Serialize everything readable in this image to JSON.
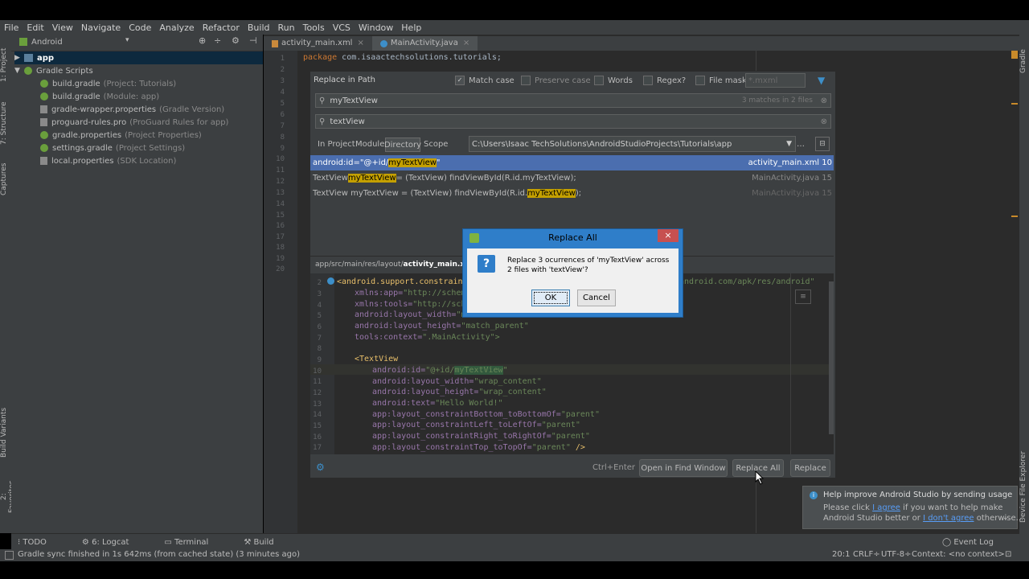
{
  "menu": [
    "File",
    "Edit",
    "View",
    "Navigate",
    "Code",
    "Analyze",
    "Refactor",
    "Build",
    "Run",
    "Tools",
    "VCS",
    "Window",
    "Help"
  ],
  "left_strip": {
    "project": "1: Project",
    "structure": "7: Structure",
    "captures": "Captures",
    "build_variants": "Build Variants",
    "favorites": "2: Favorites"
  },
  "right_strip": {
    "gradle": "Gradle",
    "device_explorer": "Device File Explorer"
  },
  "project": {
    "view": "Android",
    "tree": [
      {
        "label": "app",
        "sub": ""
      },
      {
        "label": "Gradle Scripts",
        "sub": ""
      },
      {
        "label": "build.gradle",
        "sub": "(Project: Tutorials)"
      },
      {
        "label": "build.gradle",
        "sub": "(Module: app)"
      },
      {
        "label": "gradle-wrapper.properties",
        "sub": "(Gradle Version)"
      },
      {
        "label": "proguard-rules.pro",
        "sub": "(ProGuard Rules for app)"
      },
      {
        "label": "gradle.properties",
        "sub": "(Project Properties)"
      },
      {
        "label": "settings.gradle",
        "sub": "(Project Settings)"
      },
      {
        "label": "local.properties",
        "sub": "(SDK Location)"
      }
    ]
  },
  "tabs": [
    {
      "label": "activity_main.xml"
    },
    {
      "label": "MainActivity.java"
    }
  ],
  "editor": {
    "line_numbers": [
      "1",
      "2",
      "3",
      "4",
      "5",
      "6",
      "7",
      "8",
      "9",
      "10",
      "11",
      "12",
      "13",
      "14",
      "15",
      "16",
      "17",
      "18",
      "19",
      "20"
    ],
    "line1_keyword": "package",
    "line1_rest": " com.isaactechsolutions.tutorials;"
  },
  "replace_dialog": {
    "title": "Replace in Path",
    "options": {
      "match_case": "Match case",
      "preserve_case": "Preserve case",
      "words": "Words",
      "regex": "Regex?",
      "file_mask": "File mask:",
      "file_mask_value": "*.mxml"
    },
    "find_value": "myTextView",
    "find_status": "3 matches in 2 files",
    "replace_value": "textView",
    "scopes": [
      "In Project",
      "Module",
      "Directory",
      "Scope"
    ],
    "directory_path": "C:\\Users\\Isaac TechSolutions\\AndroidStudioProjects\\Tutorials\\app",
    "results": [
      {
        "pre": "android:id=\"@+id/",
        "match": "myTextView",
        "post": "\"",
        "file": "activity_main.xml 10"
      },
      {
        "pre": "TextView ",
        "match": "myTextView",
        "post": " = (TextView) findViewById(R.id.myTextView);",
        "file": "MainActivity.java 15"
      },
      {
        "pre": "TextView myTextView = (TextView) findViewById(R.id.",
        "match": "myTextView",
        "post": ");",
        "file": "MainActivity.java 15"
      }
    ],
    "preview_path_prefix": "app/src/main/res/layout/",
    "preview_path_file": "activity_main.xml",
    "preview": {
      "line_numbers": [
        "2",
        "3",
        "4",
        "5",
        "6",
        "7",
        "8",
        "9",
        "10",
        "11",
        "12",
        "13",
        "14",
        "15",
        "16",
        "17"
      ],
      "l2a": "<android.support.constraint.",
      "l2b": "android.com/apk/res/android\"",
      "l3a": "xmlns:app=",
      "l3b": "\"http://schem",
      "l4a": "xmlns:tools=",
      "l4b": "\"http://sche",
      "l5a": "android:layout_width=",
      "l5b": "\"ma",
      "l6a": "android:layout_height=",
      "l6b": "\"match_parent\"",
      "l7a": "tools:context=",
      "l7b": "\".MainActivity\">",
      "l9": "<TextView",
      "l10a": "android:id=",
      "l10b": "\"@+id/",
      "l10c": "myTextView",
      "l10d": "\"",
      "l11a": "android:layout_width=",
      "l11b": "\"wrap_content\"",
      "l12a": "android:layout_height=",
      "l12b": "\"wrap_content\"",
      "l13a": "android:text=",
      "l13b": "\"Hello World!\"",
      "l14a": "app:layout_constraintBottom_toBottomOf=",
      "l14b": "\"parent\"",
      "l15a": "app:layout_constraintLeft_toLeftOf=",
      "l15b": "\"parent\"",
      "l16a": "app:layout_constraintRight_toRightOf=",
      "l16b": "\"parent\"",
      "l17a": "app:layout_constraintTop_toTopOf=",
      "l17b": "\"parent\"",
      "l17c": " />"
    },
    "shortcut": "Ctrl+Enter",
    "buttons": {
      "open_find": "Open in Find Window",
      "replace_all": "Replace All",
      "replace": "Replace"
    }
  },
  "confirm_dialog": {
    "title": "Replace All",
    "message": "Replace 3 ocurrences of 'myTextView' across 2 files with 'textView'?",
    "ok": "OK",
    "cancel": "Cancel"
  },
  "bottom_tools": [
    "TODO",
    "6: Logcat",
    "Terminal",
    "Build"
  ],
  "event_log": "Event Log",
  "notification": {
    "title": "Help improve Android Studio by sending usage s",
    "line1_pre": "Please click ",
    "line1_link": "I agree",
    "line1_post": " if you want to help make",
    "line2_pre": "Android Studio better or ",
    "line2_link": "I don't agree",
    "line2_post": " otherwise..."
  },
  "status": {
    "message": "Gradle sync finished in 1s 642ms (from cached state) (3 minutes ago)",
    "position": "20:1",
    "line_sep": "CRLF÷",
    "encoding": "UTF-8÷",
    "context": "Context: <no context>"
  },
  "colors": {
    "accent": "#2f7ec9",
    "highlight": "#c4a000",
    "keyword": "#cc7832",
    "string": "#6a8759",
    "attr": "#9876aa",
    "selection": "#4b6eaf"
  }
}
